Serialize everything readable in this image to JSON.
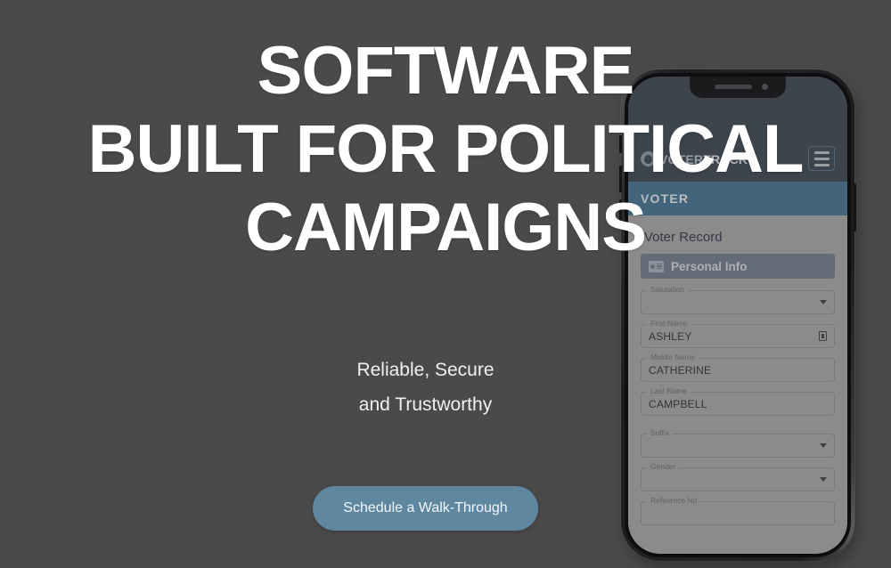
{
  "page": {
    "background_color": "#4a4a4a"
  },
  "hero": {
    "headline_line1": "SOFTWARE",
    "headline_line2": "BUILT FOR POLITICAL",
    "headline_line3": "CAMPAIGNS",
    "subtitle_line1": "Reliable, Secure",
    "subtitle_line2": "and Trustworthy",
    "cta_label": "Schedule a Walk-Through",
    "cta_color": "#5f87a0",
    "text_color": "#ffffff"
  },
  "phone": {
    "app": {
      "logo_part1": "VOTER",
      "logo_part2": "TRACK",
      "menu_icon": "hamburger-icon",
      "topbar_color": "#38424e",
      "band_label": "VOTER",
      "band_color": "#3f7192",
      "record_title": "Voter Record",
      "section": {
        "icon": "id-card-icon",
        "label": "Personal Info",
        "color": "#707a8c"
      },
      "fields": [
        {
          "label": "Salutation",
          "value": "",
          "type": "select"
        },
        {
          "label": "First Name",
          "value": "ASHLEY",
          "type": "text",
          "trailing_icon": "copy-icon"
        },
        {
          "label": "Middle Name",
          "value": "CATHERINE",
          "type": "text"
        },
        {
          "label": "Last Name",
          "value": "CAMPBELL",
          "type": "text"
        },
        {
          "label": "Suffix",
          "value": "",
          "type": "select"
        },
        {
          "label": "Gender",
          "value": "",
          "type": "select"
        },
        {
          "label": "Reference No",
          "value": "",
          "type": "text"
        }
      ]
    }
  }
}
